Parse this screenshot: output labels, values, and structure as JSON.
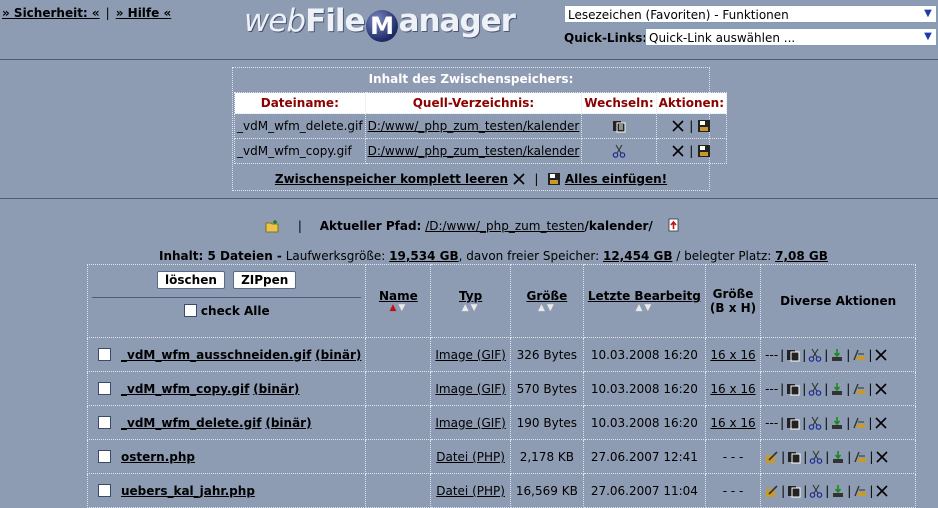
{
  "topnav": {
    "security": "» Sicherheit: «",
    "separator": "|",
    "help": "» Hilfe «"
  },
  "logo": {
    "part1": "web",
    "part2": "File",
    "m": "M",
    "part3": "anager"
  },
  "bookmarks": {
    "selected": "Lesezeichen (Favoriten) - Funktionen"
  },
  "quicklinks": {
    "label": "Quick-Links:",
    "selected": "Quick-Link auswählen ..."
  },
  "clipboard": {
    "title": "Inhalt des Zwischenspeichers:",
    "headers": [
      "Dateiname:",
      "Quell-Verzeichnis:",
      "Wechseln:",
      "Aktionen:"
    ],
    "rows": [
      {
        "name": "_vdM_wfm_delete.gif",
        "dir": "D:/www/_php_zum_testen/kalender"
      },
      {
        "name": "_vdM_wfm_copy.gif",
        "dir": "D:/www/_php_zum_testen/kalender"
      }
    ],
    "clear_label": "Zwischenspeicher komplett leeren",
    "paste_label": "Alles einfügen!"
  },
  "path": {
    "label": "Aktueller Pfad:",
    "part1": "/D:/www/_php_zum_testen",
    "part2": "/kalender/"
  },
  "summary": {
    "label": "Inhalt: 5 Dateien -",
    "disk_label": "Laufwerksgröße:",
    "disk": "19,534 GB",
    "free_label": ", davon freier Speicher:",
    "free": "12,454 GB",
    "used_label": "/ belegter Platz:",
    "used": "7,08 GB"
  },
  "files": {
    "delete_button": "löschen",
    "zip_button": "ZIPpen",
    "check_all": "check Alle",
    "headers": {
      "name": "Name",
      "type": "Typ",
      "size": "Größe",
      "modified": "Letzte Bearbeitg",
      "dims_line1": "Größe",
      "dims_line2": "(B x H)",
      "actions": "Diverse Aktionen"
    },
    "rows": [
      {
        "name": "_vdM_wfm_ausschneiden.gif",
        "kind": "(binär)",
        "type": "Image (GIF)",
        "size": "326 Bytes",
        "date": "10.03.2008 16:20",
        "dims": "16 x 16"
      },
      {
        "name": "_vdM_wfm_copy.gif",
        "kind": "(binär)",
        "type": "Image (GIF)",
        "size": "570 Bytes",
        "date": "10.03.2008 16:20",
        "dims": "16 x 16"
      },
      {
        "name": "_vdM_wfm_delete.gif",
        "kind": "(binär)",
        "type": "Image (GIF)",
        "size": "190 Bytes",
        "date": "10.03.2008 16:20",
        "dims": "16 x 16"
      },
      {
        "name": "ostern.php",
        "kind": "",
        "type": "Datei (PHP)",
        "size": "2,178 KB",
        "date": "27.06.2007 12:41",
        "dims": "- - -"
      },
      {
        "name": "uebers_kal_jahr.php",
        "kind": "",
        "type": "Datei (PHP)",
        "size": "16,569 KB",
        "date": "27.06.2007 11:04",
        "dims": "- - -"
      }
    ],
    "dash": "---"
  },
  "colors": {
    "background": "#8e9cb3",
    "header_text": "#8b0000",
    "sort_active": "#c0101a"
  }
}
